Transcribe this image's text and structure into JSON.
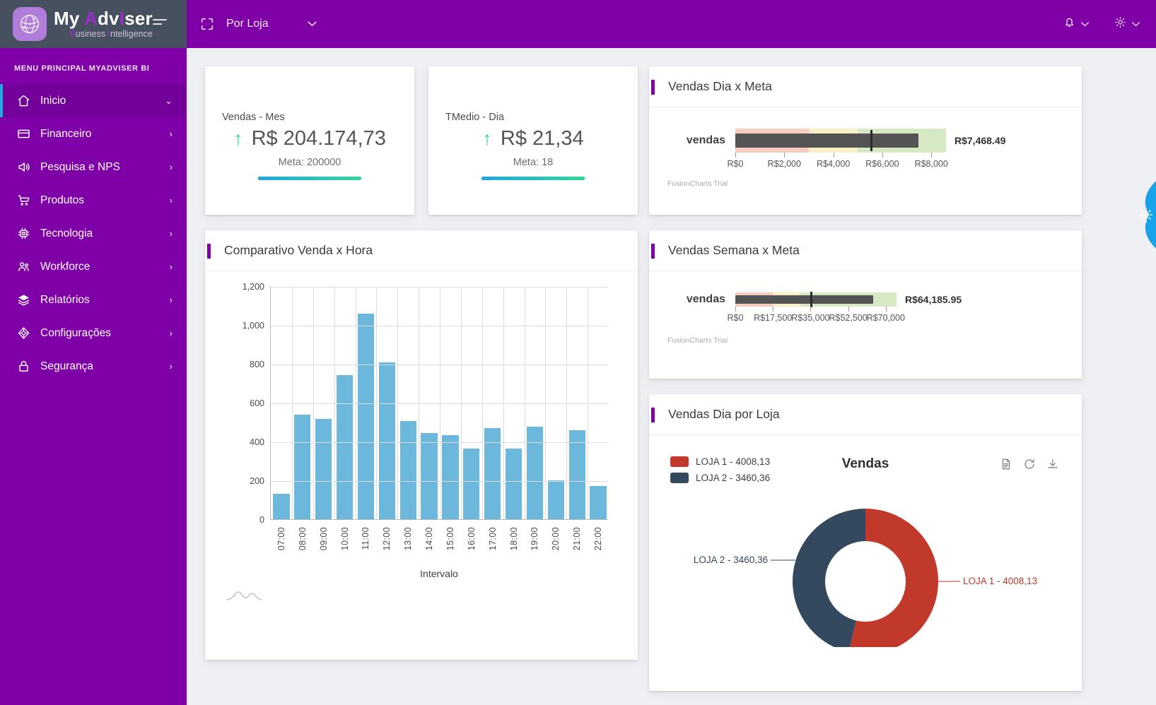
{
  "brand": {
    "title_my": "My ",
    "title_a": "A",
    "title_dv": "dv",
    "title_i": "I",
    "title_ser": "ser",
    "sub_b": "B",
    "sub_usiness": "usiness ",
    "sub_i": "I",
    "sub_ntelligence": "ntelligence",
    "logo_icon": "network-globe-icon"
  },
  "sidebar": {
    "caption": "MENU PRINCIPAL MYADVISER BI",
    "items": [
      {
        "label": "Inicio",
        "icon": "home-icon",
        "arrow": "⌄",
        "active": true
      },
      {
        "label": "Financeiro",
        "icon": "card-icon",
        "arrow": "›",
        "active": false
      },
      {
        "label": "Pesquisa e NPS",
        "icon": "speaker-icon",
        "arrow": "›",
        "active": false
      },
      {
        "label": "Produtos",
        "icon": "cart-icon",
        "arrow": "›",
        "active": false
      },
      {
        "label": "Tecnologia",
        "icon": "chip-icon",
        "arrow": "›",
        "active": false
      },
      {
        "label": "Workforce",
        "icon": "users-icon",
        "arrow": "›",
        "active": false
      },
      {
        "label": "Relatórios",
        "icon": "layers-icon",
        "arrow": "›",
        "active": false
      },
      {
        "label": "Configurações",
        "icon": "settings-node-icon",
        "arrow": "›",
        "active": false
      },
      {
        "label": "Segurança",
        "icon": "lock-icon",
        "arrow": "›",
        "active": false
      }
    ]
  },
  "topbar": {
    "expand_icon": "fullscreen-icon",
    "filter_label": "Por Loja",
    "filter_chevron": "⌄",
    "bell_icon": "bell-icon",
    "bell_chevron": "⌄",
    "gear_icon": "gear-icon",
    "gear_chevron": "⌄"
  },
  "kpis": [
    {
      "label": "Vendas - Mes",
      "arrow": "↑",
      "value": "R$ 204.174,73",
      "meta": "Meta: 200000"
    },
    {
      "label": "TMedio - Dia",
      "arrow": "↑",
      "value": "R$ 21,34",
      "meta": "Meta: 18"
    }
  ],
  "cards": {
    "vendas_dia_meta": "Vendas Dia x Meta",
    "comparativo": "Comparativo Venda x Hora",
    "vendas_semana_meta": "Vendas Semana x Meta",
    "vendas_dia_loja": "Vendas Dia por Loja"
  },
  "fusion_trial": "FusionCharts Trial",
  "colors": {
    "brand_purple": "#8000a8",
    "sidebar_active": "#73009a",
    "accent_blue": "#24a8e0",
    "kpi_green": "#2fd79a",
    "bar_blue": "#6cb8dd",
    "loja1_red": "#c0392b",
    "loja2_navy": "#34495e",
    "band_red": "#f5ccbf",
    "band_yellow": "#faf0c6",
    "band_green": "#d6e8c4",
    "bullet_bar": "#545454"
  },
  "chart_data": [
    {
      "id": "vendas_dia_meta",
      "type": "bar",
      "subtype": "bullet",
      "title": "Vendas Dia x Meta",
      "category": "vendas",
      "value": 7468.49,
      "value_label": "R$7,468.49",
      "target": 5500,
      "xlim": [
        0,
        8600
      ],
      "ticks": [
        0,
        2000,
        4000,
        6000,
        8000
      ],
      "tick_labels": [
        "R$0",
        "R$2,000",
        "R$4,000",
        "R$6,000",
        "R$8,000"
      ],
      "bands": [
        {
          "from": 0,
          "to": 3000,
          "color": "#f5ccbf"
        },
        {
          "from": 3000,
          "to": 5000,
          "color": "#faf0c6"
        },
        {
          "from": 5000,
          "to": 8600,
          "color": "#d6e8c4"
        }
      ],
      "watermark": "FusionCharts Trial"
    },
    {
      "id": "vendas_semana_meta",
      "type": "bar",
      "subtype": "bullet",
      "title": "Vendas Semana x Meta",
      "category": "vendas",
      "value": 64185.95,
      "value_label": "R$64,185.95",
      "target": 35000,
      "xlim": [
        0,
        75000
      ],
      "ticks": [
        0,
        17500,
        35000,
        52500,
        70000
      ],
      "tick_labels": [
        "R$0",
        "R$17,500",
        "R$35,000",
        "R$52,500",
        "R$70,000"
      ],
      "bands": [
        {
          "from": 0,
          "to": 17500,
          "color": "#f5ccbf"
        },
        {
          "from": 17500,
          "to": 30000,
          "color": "#faf0c6"
        },
        {
          "from": 30000,
          "to": 75000,
          "color": "#d6e8c4"
        }
      ],
      "watermark": "FusionCharts Trial"
    },
    {
      "id": "comparativo_venda_hora",
      "type": "bar",
      "title": "Comparativo Venda x Hora",
      "xlabel": "Intervalo",
      "ylabel": "",
      "ylim": [
        0,
        1200
      ],
      "yticks": [
        0,
        200,
        400,
        600,
        800,
        1000,
        1200
      ],
      "ytick_labels": [
        "0",
        "200",
        "400",
        "600",
        "800",
        "1,000",
        "1,200"
      ],
      "grid": true,
      "categories": [
        "07:00",
        "08:00",
        "09:00",
        "10:00",
        "11:00",
        "12:00",
        "13:00",
        "14:00",
        "15:00",
        "16:00",
        "17:00",
        "18:00",
        "19:00",
        "20:00",
        "21:00",
        "22:00"
      ],
      "values": [
        131,
        540,
        518,
        742,
        1060,
        808,
        505,
        445,
        432,
        365,
        470,
        363,
        478,
        200,
        458,
        170
      ],
      "series_color": "#6cb8dd"
    },
    {
      "id": "vendas_dia_por_loja",
      "type": "pie",
      "subtype": "doughnut",
      "title": "Vendas",
      "legend_position": "left",
      "slices": [
        {
          "name": "LOJA 1",
          "legend": "LOJA 1 - 4008,13",
          "label": "LOJA 1 - 4008,13",
          "value": 4008.13,
          "percent": 53.7,
          "color": "#c0392b"
        },
        {
          "name": "LOJA 2",
          "legend": "LOJA 2 - 3460,36",
          "label": "LOJA 2 - 3460,36",
          "value": 3460.36,
          "percent": 46.3,
          "color": "#34495e"
        }
      ],
      "tools": [
        "export-document-icon",
        "refresh-icon",
        "download-icon"
      ]
    }
  ]
}
